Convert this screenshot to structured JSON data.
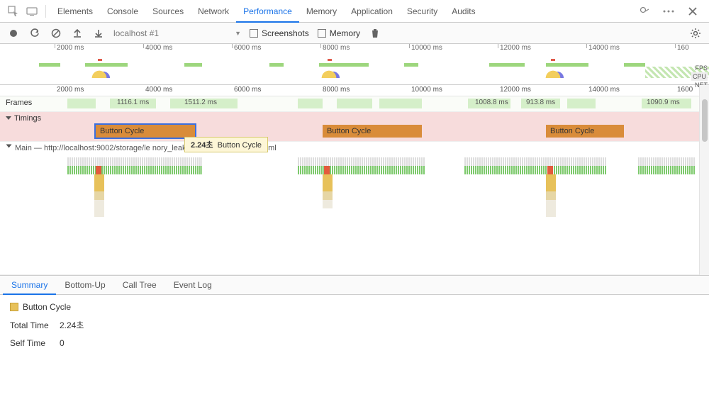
{
  "tabs": {
    "elements": "Elements",
    "console": "Console",
    "sources": "Sources",
    "network": "Network",
    "performance": "Performance",
    "memory": "Memory",
    "application": "Application",
    "security": "Security",
    "audits": "Audits"
  },
  "toolbar": {
    "target": "localhost #1",
    "screenshots": "Screenshots",
    "memory": "Memory"
  },
  "overview": {
    "ticks": [
      "2000 ms",
      "4000 ms",
      "6000 ms",
      "8000 ms",
      "10000 ms",
      "12000 ms",
      "14000 ms",
      "160"
    ],
    "metrics": [
      "FPS",
      "CPU",
      "NET"
    ]
  },
  "ruler": {
    "ticks": [
      "2000 ms",
      "4000 ms",
      "6000 ms",
      "8000 ms",
      "10000 ms",
      "12000 ms",
      "14000 ms",
      "1600"
    ]
  },
  "lanes": {
    "frames": "Frames",
    "frame_times": [
      "1116.1 ms",
      "1511.2 ms",
      "1008.8 ms",
      "913.8 ms",
      "1090.9 ms"
    ],
    "timings": "Timings",
    "timing_label": "Button Cycle",
    "main_label": "Main — http://localhost:9002/storage/le                              nory_leak_jquery-1.x_measure.html"
  },
  "tooltip": {
    "duration": "2.24초",
    "name": "Button Cycle"
  },
  "detail_tabs": {
    "summary": "Summary",
    "bottom": "Bottom-Up",
    "calltree": "Call Tree",
    "eventlog": "Event Log"
  },
  "summary": {
    "title": "Button Cycle",
    "total_k": "Total Time",
    "total_v": "2.24초",
    "self_k": "Self Time",
    "self_v": "0"
  }
}
